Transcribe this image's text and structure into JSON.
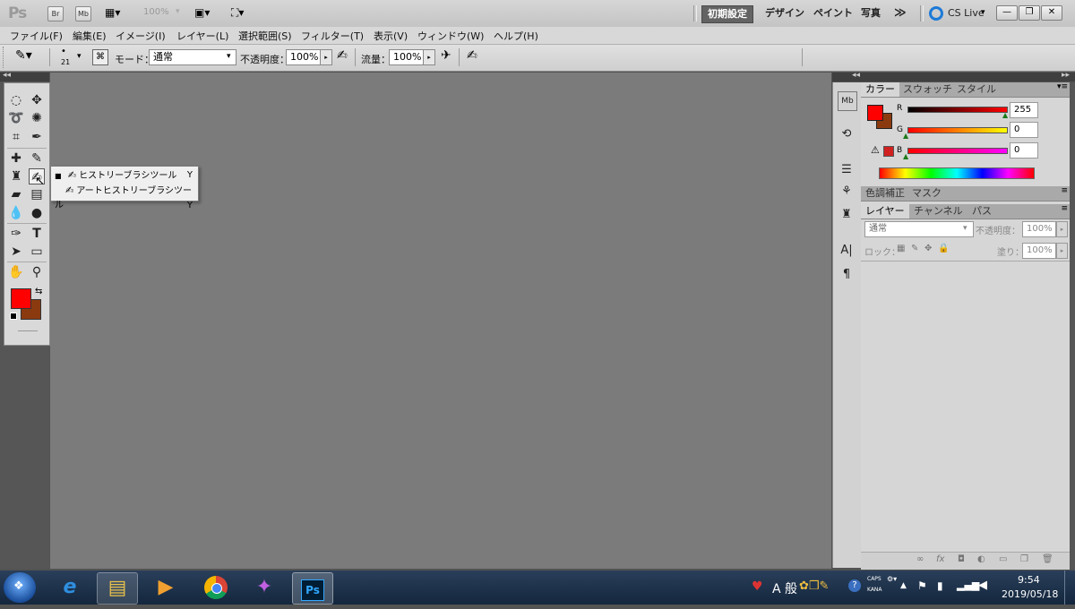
{
  "app": {
    "logo": "Ps",
    "bridge_btn": "Br",
    "minibridge_btn": "Mb",
    "zoom": "100%",
    "workspaces": [
      "初期設定",
      "デザイン",
      "ペイント",
      "写真"
    ],
    "more": "≫",
    "cs_live": "CS Live",
    "window_buttons": [
      "—",
      "❐",
      "✕"
    ]
  },
  "menu": [
    "ファイル(F)",
    "編集(E)",
    "イメージ(I)",
    "レイヤー(L)",
    "選択範囲(S)",
    "フィルター(T)",
    "表示(V)",
    "ウィンドウ(W)",
    "ヘルプ(H)"
  ],
  "options": {
    "brush_size": "21",
    "mode_label": "モード：",
    "mode_value": "通常",
    "opacity_label": "不透明度：",
    "opacity_value": "100%",
    "flow_label": "流量：",
    "flow_value": "100%"
  },
  "flyout": {
    "items": [
      {
        "label": "ヒストリーブラシツール",
        "shortcut": "Y"
      },
      {
        "label": "アートヒストリーブラシツール",
        "shortcut": "Y"
      }
    ]
  },
  "color_panel": {
    "tabs": [
      "カラー",
      "スウォッチ",
      "スタイル"
    ],
    "r_label": "R",
    "r_value": "255",
    "g_label": "G",
    "g_value": "0",
    "b_label": "B",
    "b_value": "0",
    "foreground": "#ff0000",
    "background": "#8b3a0f"
  },
  "adjust_panel": {
    "tabs": [
      "色調補正",
      "マスク"
    ]
  },
  "layers_panel": {
    "tabs": [
      "レイヤー",
      "チャンネル",
      "パス"
    ],
    "blend_mode": "通常",
    "opacity_label": "不透明度：",
    "opacity_value": "100%",
    "lock_label": "ロック：",
    "fill_label": "塗り：",
    "fill_value": "100%"
  },
  "taskbar": {
    "ime": "A 般",
    "caps": "CAPS",
    "kana": "KANA",
    "time": "9:54",
    "date": "2019/05/18"
  }
}
